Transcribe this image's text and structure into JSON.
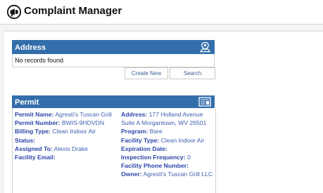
{
  "app": {
    "title": "Complaint Manager",
    "logo_icon": "megaphone-icon"
  },
  "address_panel": {
    "title": "Address",
    "icon": "location-user-icon",
    "empty_text": "No records found",
    "buttons": {
      "create": "Create New",
      "search": "Search"
    }
  },
  "permit_panel": {
    "title": "Permit",
    "icon": "id-card-icon",
    "left_fields": [
      {
        "label": "Permit Name:",
        "value": "Agresti's Tuscan Grill"
      },
      {
        "label": "Permit Number:",
        "value": "BWIS-9HDVDN"
      },
      {
        "label": "Billing Type:",
        "value": "Clean Indoor Air"
      },
      {
        "label": "Status:",
        "value": ""
      },
      {
        "label": "Assigned To:",
        "value": "Alexis Drake"
      },
      {
        "label": "Facility Email:",
        "value": ""
      }
    ],
    "right_fields": [
      {
        "label": "Address:",
        "value": "177 Holland Avenue Suite A Morgantown, WV 26501"
      },
      {
        "label": "Program:",
        "value": "Bare"
      },
      {
        "label": "Facility Type:",
        "value": "Clean Indoor Air"
      },
      {
        "label": "Expiration Date:",
        "value": ""
      },
      {
        "label": "Inspection Frequency:",
        "value": "0"
      },
      {
        "label": "Facility Phone Number:",
        "value": ""
      },
      {
        "label": "Owner:",
        "value": "Agresti's Tuscan Grill LLC"
      }
    ]
  },
  "colors": {
    "header_blue": "#336eab",
    "link_blue": "#3f5fb0"
  }
}
